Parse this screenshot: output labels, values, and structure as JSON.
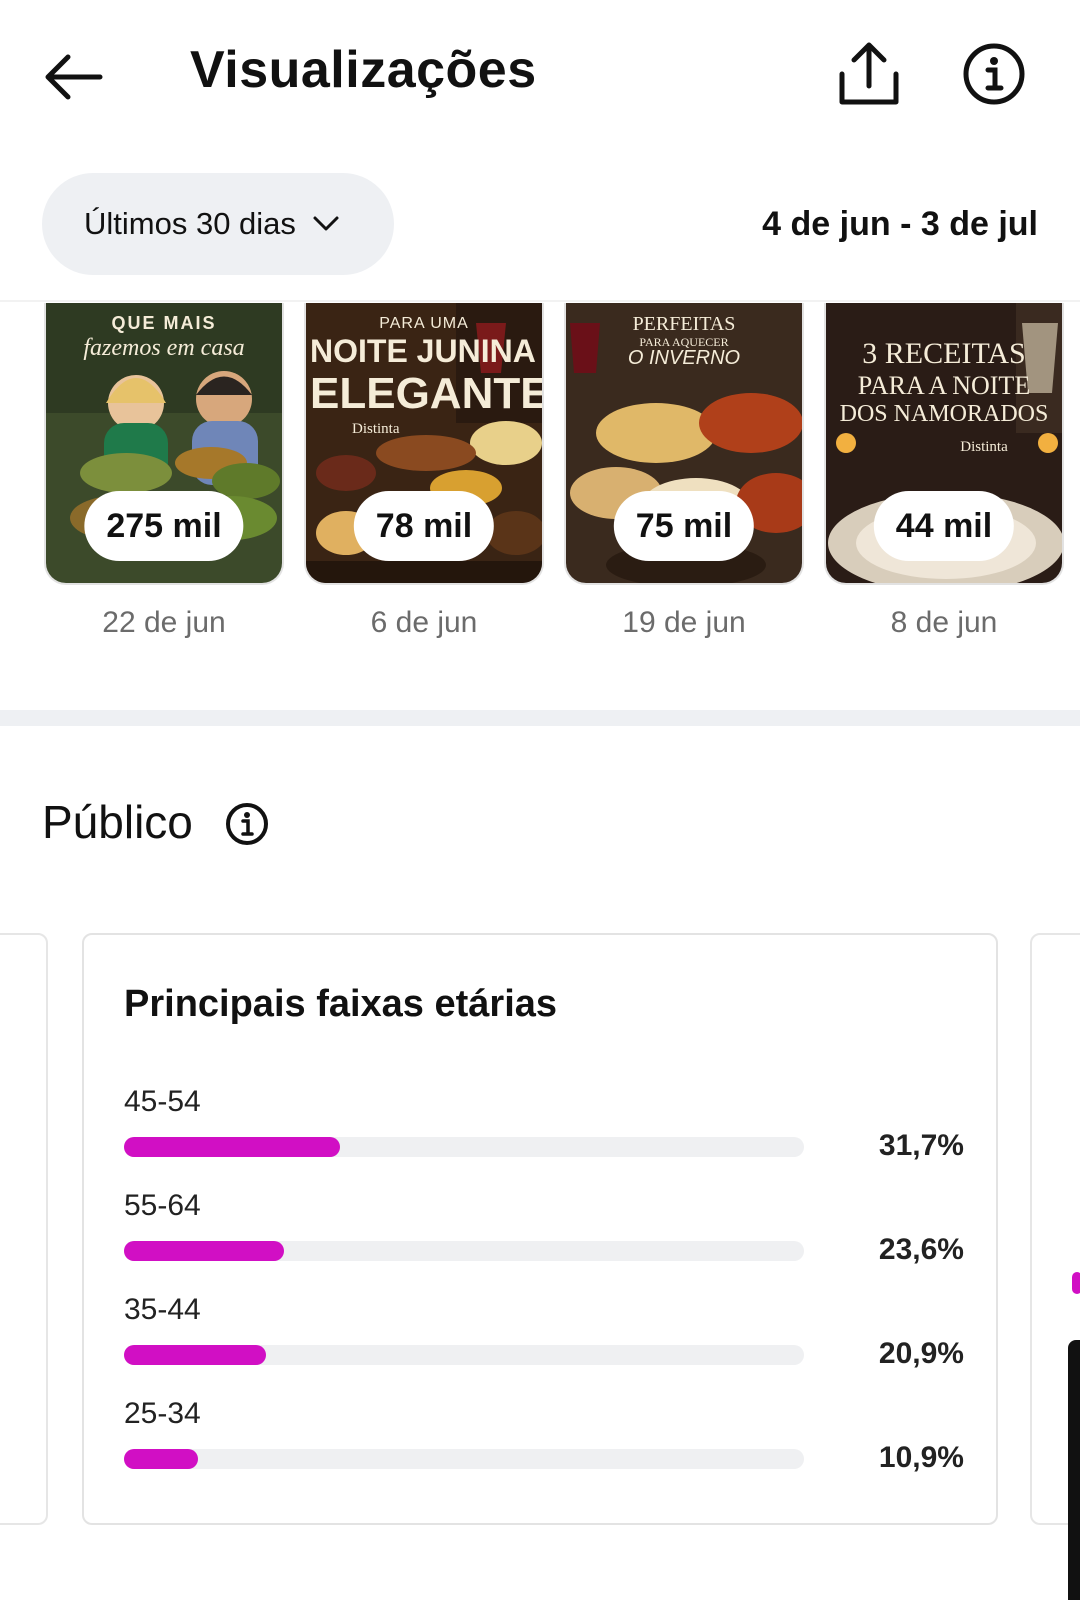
{
  "header": {
    "title": "Visualizações",
    "back_icon": "arrow-left-icon",
    "share_icon": "share-icon",
    "info_icon": "info-icon"
  },
  "filter": {
    "range_label": "Últimos 30 dias",
    "date_range": "4 de jun - 3 de jul"
  },
  "posts": [
    {
      "overlay_lines": [
        "QUE MAIS",
        "fazemos em casa"
      ],
      "count": "275 mil",
      "date": "22 de jun",
      "palette": [
        "#3c4a2a",
        "#6b5a34",
        "#2e3a22"
      ]
    },
    {
      "overlay_lines": [
        "PARA UMA",
        "NOITE JUNINA",
        "ELEGANTE",
        "Distinta"
      ],
      "count": "78 mil",
      "date": "6 de jun",
      "palette": [
        "#3a2414",
        "#6a3e1c",
        "#2a1a10"
      ]
    },
    {
      "overlay_lines": [
        "PERFEITAS",
        "PARA AQUECER",
        "O INVERNO"
      ],
      "count": "75 mil",
      "date": "19 de jun",
      "palette": [
        "#3a2a1e",
        "#7a4a28",
        "#241810"
      ]
    },
    {
      "overlay_lines": [
        "3 RECEITAS",
        "PARA A NOITE",
        "DOS NAMORADOS",
        "Distinta"
      ],
      "count": "44 mil",
      "date": "8 de jun",
      "palette": [
        "#2a1c16",
        "#5a3a2a",
        "#1a120e"
      ]
    }
  ],
  "audience": {
    "title": "Público",
    "card_title": "Principais faixas etárias",
    "accent": "#d10fc4",
    "age_groups": [
      {
        "label": "45-54",
        "pct": "31,7%",
        "value": 31.7
      },
      {
        "label": "55-64",
        "pct": "23,6%",
        "value": 23.6
      },
      {
        "label": "35-44",
        "pct": "20,9%",
        "value": 20.9
      },
      {
        "label": "25-34",
        "pct": "10,9%",
        "value": 10.9
      }
    ]
  }
}
